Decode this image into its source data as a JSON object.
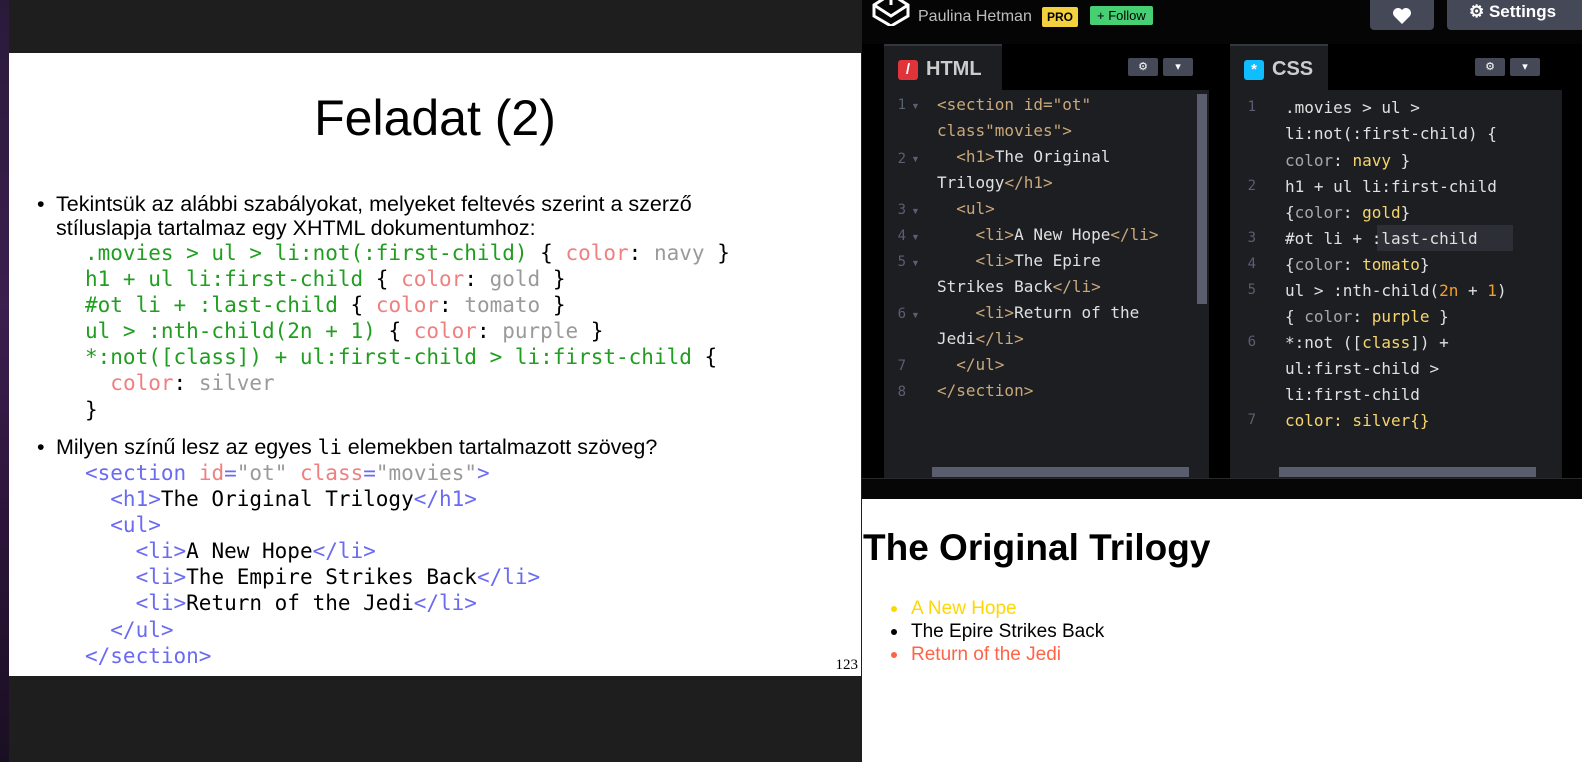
{
  "slide": {
    "title": "Feladat (2)",
    "bullet1": {
      "line1": "Tekintsük az alábbi szabályokat, melyeket feltevés szerint a szerző",
      "line2": "stíluslapja tartalmaz egy XHTML dokumentumhoz:"
    },
    "rules": [
      {
        "sel": ".movies > ul > li:not(:first-child)",
        "prop": "color",
        "val": "navy"
      },
      {
        "sel": "h1 + ul li:first-child",
        "prop": "color",
        "val": "gold"
      },
      {
        "sel": "#ot li + :last-child",
        "prop": "color",
        "val": "tomato"
      },
      {
        "sel": "ul > :nth-child(2n + 1)",
        "prop": "color",
        "val": "purple"
      },
      {
        "sel": "*:not([class]) + ul:first-child > li:first-child",
        "prop": "color",
        "val": "silver"
      }
    ],
    "bullet2": {
      "before": "Milyen színű lesz az egyes ",
      "code": "li",
      "after": " elemekben tartalmazott szöveg?"
    },
    "markup": {
      "section_open": "section",
      "id_attr": "id",
      "id_val": "\"ot\"",
      "class_attr": "class",
      "class_val": "\"movies\"",
      "h1_text": "The Original Trilogy",
      "li1": "A New Hope",
      "li2": "The Empire Strikes Back",
      "li3": "Return of the Jedi"
    },
    "page_number": "123"
  },
  "pen": {
    "author": "Paulina Hetman",
    "pro_label": "PRO",
    "follow_label": "Follow",
    "settings_label": "Settings",
    "html_tab": "HTML",
    "css_tab": "CSS",
    "html_editor": {
      "line_numbers": [
        "1",
        "2",
        "3",
        "4",
        "5",
        "6",
        "7",
        "8"
      ],
      "section_line_a": "<section id=\"ot\"",
      "section_line_b": "class\"movies\">",
      "h1_line_a": "The Original",
      "h1_line_b": "Trilogy",
      "li1": "A New Hope",
      "li2_a": "The Epire",
      "li2_b": "Strikes Back",
      "li3_a": "Return of the",
      "li3_b": "Jedi"
    },
    "css_editor": {
      "line_numbers": [
        "1",
        "2",
        "3",
        "4",
        "5",
        "6",
        "7"
      ],
      "l1a": ".movies > ul >",
      "l1b": "li:not(:first-child) {",
      "l1c_prop": "color",
      "l1c_val": "navy",
      "l2a": "h1 + ul li:first-child",
      "l2b_prop": "color",
      "l2b_val": "gold",
      "l3a": "#ot li + :last-child",
      "l4_prop": "color",
      "l4_val": "tomato",
      "l5a": "ul > :nth-child(",
      "l5a_n": "2n",
      "l5a_1": "1",
      "l5b_prop": "color",
      "l5b_val": "purple",
      "l6a_pre": "*:not ([",
      "l6a_attr": "class",
      "l6a_post": "]) +",
      "l6b": "ul:first-child >",
      "l6c": "li:first-child",
      "l7": "color: silver{}"
    },
    "preview": {
      "title": "The Original Trilogy",
      "items": [
        {
          "text": "A New Hope",
          "color": "#ffd700"
        },
        {
          "text": "The Epire Strikes Back",
          "color": "#000000"
        },
        {
          "text": "Return of the Jedi",
          "color": "#ff6347"
        }
      ]
    }
  }
}
